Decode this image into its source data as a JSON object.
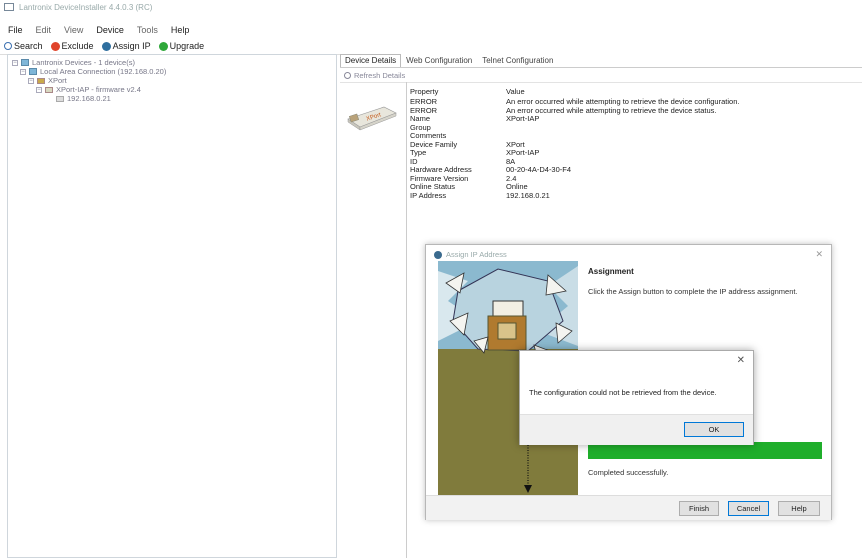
{
  "window": {
    "title": "Lantronix DeviceInstaller 4.4.0.3 (RC)"
  },
  "menu": [
    "File",
    "Edit",
    "View",
    "Device",
    "Tools",
    "Help"
  ],
  "toolbar": {
    "search": "Search",
    "exclude": "Exclude",
    "assign_ip": "Assign IP",
    "upgrade": "Upgrade"
  },
  "tree": {
    "root": "Lantronix Devices - 1 device(s)",
    "conn": "Local Area Connection (192.168.0.20)",
    "group": "XPort",
    "device": "XPort-IAP - firmware v2.4",
    "ip": "192.168.0.21"
  },
  "tabs": [
    "Device Details",
    "Web Configuration",
    "Telnet Configuration"
  ],
  "refresh_label": "Refresh Details",
  "device_label": "XPort",
  "properties": {
    "header_key": "Property",
    "header_value": "Value",
    "rows": [
      {
        "k": "ERROR",
        "v": "An error occurred while attempting to retrieve the device configuration."
      },
      {
        "k": "ERROR",
        "v": "An error occurred while attempting to retrieve the device status."
      },
      {
        "k": "Name",
        "v": "XPort-IAP"
      },
      {
        "k": "Group",
        "v": ""
      },
      {
        "k": "Comments",
        "v": ""
      },
      {
        "k": "Device Family",
        "v": "XPort"
      },
      {
        "k": "Type",
        "v": "XPort-IAP"
      },
      {
        "k": "ID",
        "v": "8A"
      },
      {
        "k": "Hardware Address",
        "v": "00-20-4A-D4-30-F4"
      },
      {
        "k": "Firmware Version",
        "v": "2.4"
      },
      {
        "k": "Online Status",
        "v": "Online"
      },
      {
        "k": "IP Address",
        "v": "192.168.0.21"
      }
    ]
  },
  "assign_dialog": {
    "title": "Assign IP Address",
    "heading": "Assignment",
    "instruction": "Click the Assign button to complete the IP address assignment.",
    "progress": 1.0,
    "completed": "Completed successfully.",
    "finish": "Finish",
    "cancel": "Cancel",
    "help": "Help",
    "progress_color": "#1fae2b"
  },
  "error_dialog": {
    "message": "The configuration could not be retrieved from the device.",
    "ok": "OK"
  }
}
